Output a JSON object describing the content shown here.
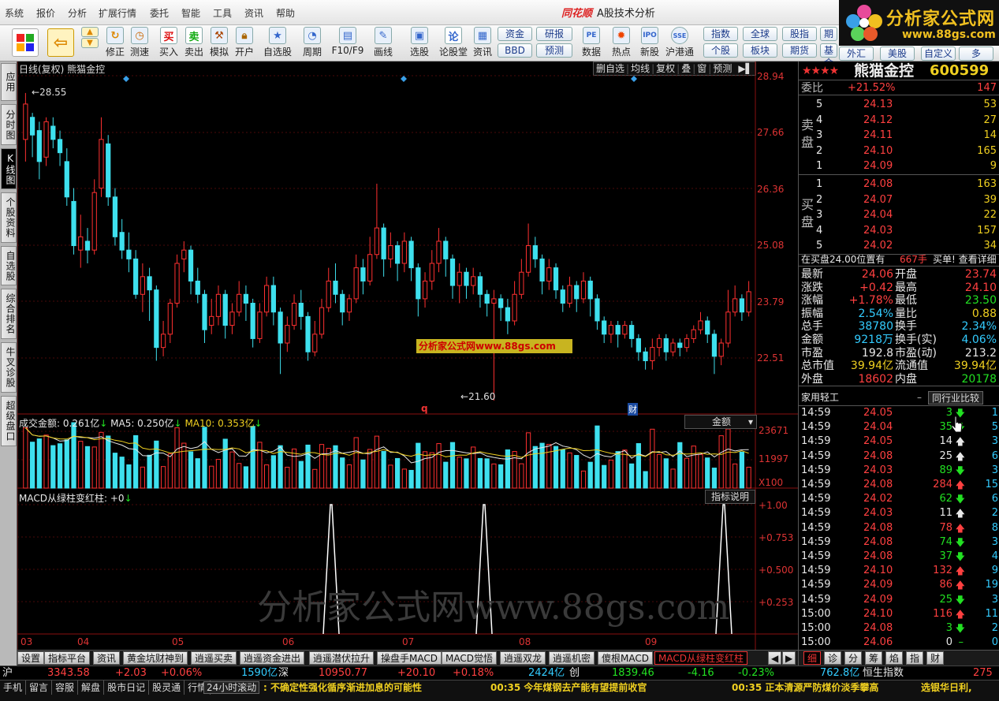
{
  "menu": [
    "系统",
    "报价",
    "分析",
    "扩展行情",
    "委托",
    "智能",
    "工具",
    "资讯",
    "帮助"
  ],
  "app": {
    "brand": "同花顺",
    "title": "A股技术分析"
  },
  "logo": {
    "text": "分析家公式网",
    "url": "www.88gs.com"
  },
  "toolbar": [
    {
      "label": "修正",
      "icon": "arrow-up-icon"
    },
    {
      "label": "测速",
      "icon": "speed-icon"
    },
    {
      "label": "买入",
      "icon": "buy-icon"
    },
    {
      "label": "卖出",
      "icon": "sell-icon"
    },
    {
      "label": "模拟",
      "icon": "hammer-icon"
    },
    {
      "label": "开户",
      "icon": "lock-icon"
    },
    {
      "label": "自选股",
      "icon": "star-icon"
    },
    {
      "label": "周期",
      "icon": "clock-icon"
    },
    {
      "label": "F10/F9",
      "icon": "doc-icon"
    },
    {
      "label": "画线",
      "icon": "pen-icon"
    },
    {
      "label": "选股",
      "icon": "screen-icon"
    },
    {
      "label": "论股堂",
      "icon": "forum-icon"
    },
    {
      "label": "资讯",
      "icon": "news-icon"
    },
    {
      "label": "数据",
      "icon": "pe-icon"
    },
    {
      "label": "热点",
      "icon": "hot-icon"
    },
    {
      "label": "新股",
      "icon": "ipo-icon"
    },
    {
      "label": "沪港通",
      "icon": "hk-icon"
    }
  ],
  "toolbar_small": {
    "row1": [
      "资金",
      "研报",
      "指数",
      "全球",
      "股指",
      "期"
    ],
    "row2": [
      "BBD",
      "预测",
      "个股",
      "板块",
      "期货",
      "基金",
      "外汇",
      "美股",
      "自定义",
      "多"
    ]
  },
  "leftnav": [
    "应用",
    "分时图",
    "K线图",
    "个股资料",
    "自选股",
    "综合排名",
    "牛叉诊股",
    "超级盘口"
  ],
  "chart": {
    "header": "日线(复权)  熊猫金控",
    "header_btns": [
      "删自选",
      "均线",
      "复权",
      "叠",
      "窗",
      "预测"
    ],
    "price_axis": [
      "28.94",
      "27.66",
      "26.36",
      "25.08",
      "23.79",
      "22.51"
    ],
    "high_label": "28.55",
    "low_label": "21.60",
    "watermark_small": "分析家公式网www.88gs.com",
    "watermark_big": "分析家公式网www.88gs.com",
    "event_marks": [
      "q",
      "财"
    ],
    "vol_header": {
      "name": "成交金额:",
      "value": "0.261亿",
      "ma5": "MA5: 0.250亿",
      "ma10": "MA10: 0.353亿",
      "select": "金额"
    },
    "vol_axis": [
      "23671",
      "11997",
      "X100"
    ],
    "macd_header": {
      "name": "MACD从绿柱变红柱:",
      "value": "+0"
    },
    "macd_btn": "指标说明",
    "macd_axis": [
      "1.00",
      "0.753",
      "0.500",
      "0.253"
    ],
    "months": [
      "03",
      "04",
      "05",
      "06",
      "07",
      "08",
      "09"
    ]
  },
  "chart_data": {
    "type": "candlestick",
    "price_range": [
      21.6,
      28.94
    ],
    "high": 28.55,
    "low": 21.6,
    "candles": [
      [
        27.5,
        28.3,
        28.55,
        27.0
      ],
      [
        28.0,
        27.6,
        28.1,
        27.1
      ],
      [
        27.7,
        27.0,
        27.9,
        26.6
      ],
      [
        27.1,
        27.9,
        28.0,
        26.9
      ],
      [
        27.8,
        27.5,
        28.0,
        27.3
      ],
      [
        27.5,
        27.2,
        27.7,
        26.9
      ],
      [
        27.0,
        26.2,
        27.3,
        26.0
      ],
      [
        26.1,
        25.1,
        26.4,
        24.9
      ],
      [
        25.0,
        25.3,
        25.8,
        24.6
      ],
      [
        25.2,
        25.0,
        25.5,
        24.7
      ],
      [
        25.0,
        26.3,
        26.6,
        24.9
      ],
      [
        26.4,
        27.5,
        28.0,
        26.2
      ],
      [
        27.4,
        26.2,
        27.6,
        26.0
      ],
      [
        26.2,
        25.3,
        26.4,
        25.1
      ],
      [
        25.4,
        25.0,
        25.7,
        24.8
      ],
      [
        25.0,
        24.8,
        25.4,
        24.5
      ],
      [
        24.8,
        24.0,
        25.0,
        23.9
      ],
      [
        24.0,
        24.4,
        24.7,
        23.6
      ],
      [
        24.4,
        24.1,
        24.6,
        23.4
      ],
      [
        24.1,
        22.8,
        24.2,
        22.5
      ],
      [
        22.8,
        23.1,
        23.4,
        22.6
      ],
      [
        23.1,
        23.8,
        23.9,
        22.9
      ],
      [
        23.8,
        24.7,
        24.9,
        23.7
      ],
      [
        24.8,
        25.0,
        25.2,
        24.5
      ],
      [
        25.0,
        24.3,
        25.1,
        24.0
      ],
      [
        24.3,
        24.0,
        24.6,
        23.8
      ],
      [
        24.0,
        23.2,
        24.1,
        22.9
      ],
      [
        23.3,
        23.5,
        23.9,
        23.1
      ],
      [
        23.5,
        24.0,
        24.2,
        23.3
      ],
      [
        24.0,
        23.3,
        24.1,
        23.0
      ],
      [
        23.3,
        23.6,
        23.8,
        23.1
      ],
      [
        23.6,
        24.0,
        24.3,
        23.5
      ],
      [
        24.0,
        23.8,
        24.2,
        23.4
      ],
      [
        23.8,
        23.0,
        23.9,
        22.8
      ],
      [
        23.0,
        23.6,
        23.8,
        22.9
      ],
      [
        23.6,
        24.2,
        24.4,
        23.5
      ],
      [
        24.2,
        23.6,
        24.4,
        23.3
      ],
      [
        23.6,
        22.9,
        23.7,
        22.2
      ],
      [
        22.9,
        23.3,
        23.5,
        22.7
      ],
      [
        23.3,
        23.8,
        24.0,
        23.2
      ],
      [
        23.8,
        23.5,
        24.1,
        23.2
      ],
      [
        23.5,
        22.7,
        23.6,
        22.5
      ],
      [
        22.7,
        23.1,
        23.4,
        22.6
      ],
      [
        23.1,
        23.7,
        23.9,
        23.0
      ],
      [
        23.7,
        24.3,
        24.6,
        23.6
      ],
      [
        24.3,
        24.0,
        24.7,
        23.8
      ],
      [
        24.0,
        23.6,
        24.1,
        23.3
      ],
      [
        23.6,
        23.9,
        24.0,
        23.4
      ],
      [
        23.9,
        24.6,
        24.9,
        23.8
      ],
      [
        24.6,
        24.3,
        24.8,
        24.0
      ],
      [
        24.3,
        24.9,
        25.3,
        24.2
      ],
      [
        24.9,
        25.5,
        26.5,
        24.8
      ],
      [
        25.5,
        24.8,
        25.6,
        24.4
      ],
      [
        24.8,
        25.1,
        25.4,
        24.6
      ],
      [
        25.1,
        24.7,
        25.2,
        24.3
      ],
      [
        24.7,
        25.2,
        25.4,
        24.5
      ],
      [
        25.2,
        24.6,
        25.3,
        24.3
      ],
      [
        24.6,
        23.9,
        24.7,
        23.5
      ],
      [
        23.9,
        24.3,
        24.5,
        23.7
      ],
      [
        24.3,
        24.7,
        25.0,
        24.1
      ],
      [
        24.7,
        25.2,
        25.5,
        24.5
      ],
      [
        25.2,
        24.8,
        25.3,
        24.4
      ],
      [
        24.8,
        24.2,
        24.9,
        23.9
      ],
      [
        24.2,
        24.5,
        24.7,
        23.8
      ],
      [
        24.5,
        24.2,
        24.6,
        23.9
      ],
      [
        24.2,
        24.4,
        24.6,
        24.0
      ],
      [
        24.4,
        24.0,
        24.5,
        23.7
      ],
      [
        24.0,
        23.8,
        24.1,
        23.5
      ],
      [
        23.8,
        23.9,
        24.1,
        21.6
      ],
      [
        23.9,
        23.7,
        24.0,
        23.4
      ],
      [
        23.7,
        23.4,
        23.9,
        23.1
      ],
      [
        23.4,
        24.0,
        24.3,
        23.3
      ],
      [
        24.0,
        24.5,
        24.8,
        23.9
      ],
      [
        24.5,
        25.1,
        25.6,
        24.4
      ],
      [
        25.1,
        24.8,
        25.3,
        24.6
      ],
      [
        24.8,
        24.3,
        24.9,
        24.0
      ],
      [
        24.3,
        24.6,
        24.8,
        24.1
      ],
      [
        24.6,
        24.1,
        24.7,
        23.9
      ],
      [
        24.1,
        23.8,
        24.2,
        23.6
      ],
      [
        23.8,
        24.2,
        24.4,
        23.7
      ],
      [
        24.2,
        23.9,
        24.3,
        23.6
      ],
      [
        23.9,
        24.3,
        24.5,
        23.8
      ],
      [
        24.3,
        23.9,
        24.4,
        23.5
      ],
      [
        23.9,
        23.4,
        24.0,
        23.2
      ],
      [
        23.4,
        23.1,
        23.5,
        22.9
      ],
      [
        23.1,
        23.3,
        23.4,
        22.9
      ],
      [
        23.3,
        23.1,
        23.4,
        22.8
      ],
      [
        23.1,
        23.3,
        23.4,
        23.0
      ],
      [
        23.3,
        23.0,
        23.4,
        22.8
      ],
      [
        23.0,
        22.7,
        23.1,
        22.5
      ],
      [
        22.7,
        22.5,
        22.8,
        22.3
      ],
      [
        22.5,
        22.8,
        23.0,
        22.3
      ],
      [
        22.8,
        23.0,
        23.1,
        22.6
      ],
      [
        23.0,
        22.7,
        23.1,
        22.5
      ],
      [
        22.7,
        22.9,
        23.0,
        22.6
      ],
      [
        22.9,
        22.8,
        23.0,
        22.6
      ],
      [
        22.8,
        23.0,
        23.1,
        22.7
      ],
      [
        23.0,
        23.2,
        23.3,
        22.9
      ],
      [
        23.2,
        23.4,
        23.6,
        23.1
      ],
      [
        23.4,
        23.1,
        23.5,
        22.9
      ],
      [
        23.1,
        22.6,
        23.2,
        22.2
      ],
      [
        22.6,
        22.9,
        23.0,
        22.4
      ],
      [
        22.9,
        23.6,
        24.1,
        22.8
      ],
      [
        23.6,
        23.9,
        24.2,
        23.5
      ],
      [
        23.9,
        23.6,
        24.0,
        23.4
      ],
      [
        23.6,
        24.06,
        24.3,
        23.5
      ]
    ],
    "volume_axis": [
      11997,
      23671
    ],
    "volume_unit": "X100",
    "macd_signal_peaks": 3,
    "macd_axis_range": [
      0,
      1
    ]
  },
  "quote": {
    "name": "熊猫金控",
    "code": "600599",
    "weibi_label": "委比",
    "weibi": "+21.52%",
    "weicha": "147",
    "sell_label": [
      "卖",
      "盘"
    ],
    "buy_label": [
      "买",
      "盘"
    ],
    "sell": [
      {
        "lv": "5",
        "p": "24.13",
        "v": "53"
      },
      {
        "lv": "4",
        "p": "24.12",
        "v": "27"
      },
      {
        "lv": "3",
        "p": "24.11",
        "v": "14"
      },
      {
        "lv": "2",
        "p": "24.10",
        "v": "165"
      },
      {
        "lv": "1",
        "p": "24.09",
        "v": "9"
      }
    ],
    "buy": [
      {
        "lv": "1",
        "p": "24.08",
        "v": "163"
      },
      {
        "lv": "2",
        "p": "24.07",
        "v": "39"
      },
      {
        "lv": "3",
        "p": "24.04",
        "v": "22"
      },
      {
        "lv": "4",
        "p": "24.03",
        "v": "157"
      },
      {
        "lv": "5",
        "p": "24.02",
        "v": "34"
      }
    ],
    "notice": {
      "a": "在买盘24.00位置有",
      "b": "667手",
      "c": "买单! 查看详细"
    },
    "stats": [
      {
        "l": "最新",
        "lv": "24.06",
        "r": "开盘",
        "rv": "23.74"
      },
      {
        "l": "涨跌",
        "lv": "+0.42",
        "r": "最高",
        "rv": "24.10"
      },
      {
        "l": "涨幅",
        "lv": "+1.78%",
        "r": "最低",
        "rv": "23.50"
      },
      {
        "l": "振幅",
        "lv": "2.54%",
        "r": "量比",
        "rv": "0.88"
      },
      {
        "l": "总手",
        "lv": "38780",
        "r": "换手",
        "rv": "2.34%"
      },
      {
        "l": "金额",
        "lv": "9218万",
        "r": "换手(实)",
        "rv": "4.06%"
      },
      {
        "l": "市盈",
        "lv": "192.8",
        "r": "市盈(动)",
        "rv": "213.2"
      },
      {
        "l": "总市值",
        "lv": "39.94亿",
        "r": "流通值",
        "rv": "39.94亿"
      },
      {
        "l": "外盘",
        "lv": "18602",
        "r": "内盘",
        "rv": "20178"
      }
    ],
    "industry": "家用轻工",
    "industry_btn": "同行业比较",
    "ticks": [
      {
        "t": "14:59",
        "p": "24.05",
        "v": "3",
        "d": "down",
        "n": "1"
      },
      {
        "t": "14:59",
        "p": "24.04",
        "v": "35",
        "d": "down",
        "n": "5"
      },
      {
        "t": "14:59",
        "p": "24.05",
        "v": "14",
        "d": "up",
        "n": "3"
      },
      {
        "t": "14:59",
        "p": "24.08",
        "v": "25",
        "d": "up",
        "n": "6"
      },
      {
        "t": "14:59",
        "p": "24.03",
        "v": "89",
        "d": "down",
        "n": "3"
      },
      {
        "t": "14:59",
        "p": "24.08",
        "v": "284",
        "d": "up",
        "n": "15"
      },
      {
        "t": "14:59",
        "p": "24.02",
        "v": "62",
        "d": "down",
        "n": "6"
      },
      {
        "t": "14:59",
        "p": "24.03",
        "v": "11",
        "d": "up",
        "n": "2"
      },
      {
        "t": "14:59",
        "p": "24.08",
        "v": "78",
        "d": "up",
        "n": "8"
      },
      {
        "t": "14:59",
        "p": "24.08",
        "v": "74",
        "d": "down",
        "n": "3"
      },
      {
        "t": "14:59",
        "p": "24.08",
        "v": "37",
        "d": "down",
        "n": "4"
      },
      {
        "t": "14:59",
        "p": "24.10",
        "v": "132",
        "d": "up",
        "n": "9"
      },
      {
        "t": "14:59",
        "p": "24.09",
        "v": "86",
        "d": "up",
        "n": "19"
      },
      {
        "t": "14:59",
        "p": "24.09",
        "v": "25",
        "d": "down",
        "n": "3"
      },
      {
        "t": "15:00",
        "p": "24.10",
        "v": "116",
        "d": "up",
        "n": "11"
      },
      {
        "t": "15:00",
        "p": "24.08",
        "v": "3",
        "d": "down",
        "n": "2"
      },
      {
        "t": "15:00",
        "p": "24.06",
        "v": "0",
        "d": "none",
        "n": "0"
      }
    ],
    "bottom_tabs": [
      "细",
      "诊",
      "分",
      "筹",
      "焰",
      "指",
      "财"
    ]
  },
  "tabs": [
    "设置",
    "指标平台",
    "资讯",
    "黄金坑财神到",
    "逍遥买卖",
    "逍遥资金进出",
    "逍遥潜伏拉升",
    "操盘手MACD",
    "MACD觉悟",
    "逍遥双龙",
    "逍遥机密",
    "傻根MACD",
    "MACD从绿柱变红柱"
  ],
  "index_bar": {
    "sh": "沪",
    "sh_v": "3343.58",
    "sh_c": "+2.03",
    "sh_p": "+0.06%",
    "sh_a": "1590亿",
    "sz": "深",
    "sz_v": "10950.77",
    "sz_c": "+20.10",
    "sz_p": "+0.18%",
    "sz_a": "2424亿",
    "cy": "创",
    "cy_v": "1839.46",
    "cy_c": "-4.16",
    "cy_p": "-0.23%",
    "cy_a": "762.8亿",
    "hs": "恒生指数",
    "hs_v": "275"
  },
  "status": [
    "手机",
    "留言",
    "容服",
    "解盘",
    "股市日记",
    "股灵通",
    "行情"
  ],
  "news": {
    "tag": "24小时滚动",
    "n1": "不确定性强化循序渐进加息的可能性",
    "t2": "00:35",
    "n2": "今年煤钢去产能有望提前收官",
    "t3": "00:35",
    "n3": "正本清源严防煤价淡季攀高",
    "n4": "选银华日利,"
  }
}
